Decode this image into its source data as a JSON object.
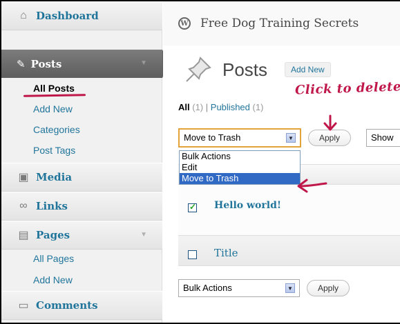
{
  "sidebar": {
    "dashboard": {
      "label": "Dashboard",
      "icon": "home-icon"
    },
    "posts": {
      "label": "Posts",
      "icon": "pushpin-icon"
    },
    "posts_submenu": [
      "All Posts",
      "Add New",
      "Categories",
      "Post Tags"
    ],
    "media": {
      "label": "Media",
      "icon": "media-icon"
    },
    "links": {
      "label": "Links",
      "icon": "link-icon"
    },
    "pages": {
      "label": "Pages",
      "icon": "pages-icon"
    },
    "pages_submenu": [
      "All Pages",
      "Add New"
    ],
    "comments": {
      "label": "Comments",
      "icon": "comment-icon"
    }
  },
  "header": {
    "site_title": "Free Dog Training Secrets",
    "page_title": "Posts",
    "add_new": "Add New"
  },
  "annotation": {
    "text": "Click to delete",
    "color": "#c0174b"
  },
  "filters": {
    "all": "All",
    "all_count": "(1)",
    "separator": "|",
    "published": "Published",
    "published_count": "(1)"
  },
  "bulk_top": {
    "selected": "Move to Trash",
    "apply": "Apply",
    "show": "Show"
  },
  "dropdown": {
    "options": [
      "Bulk Actions",
      "Edit",
      "Move to Trash"
    ],
    "selected_index": 2
  },
  "table": {
    "rows": [
      {
        "title": "Hello world!",
        "checked": true
      }
    ],
    "footer_column": "Title"
  },
  "bulk_bottom": {
    "selected": "Bulk Actions",
    "apply": "Apply"
  },
  "colors": {
    "link": "#21759b",
    "active_menu": "#6c6c6c",
    "annotation": "#c0174b",
    "dropdown_highlight": "#316ac5"
  }
}
